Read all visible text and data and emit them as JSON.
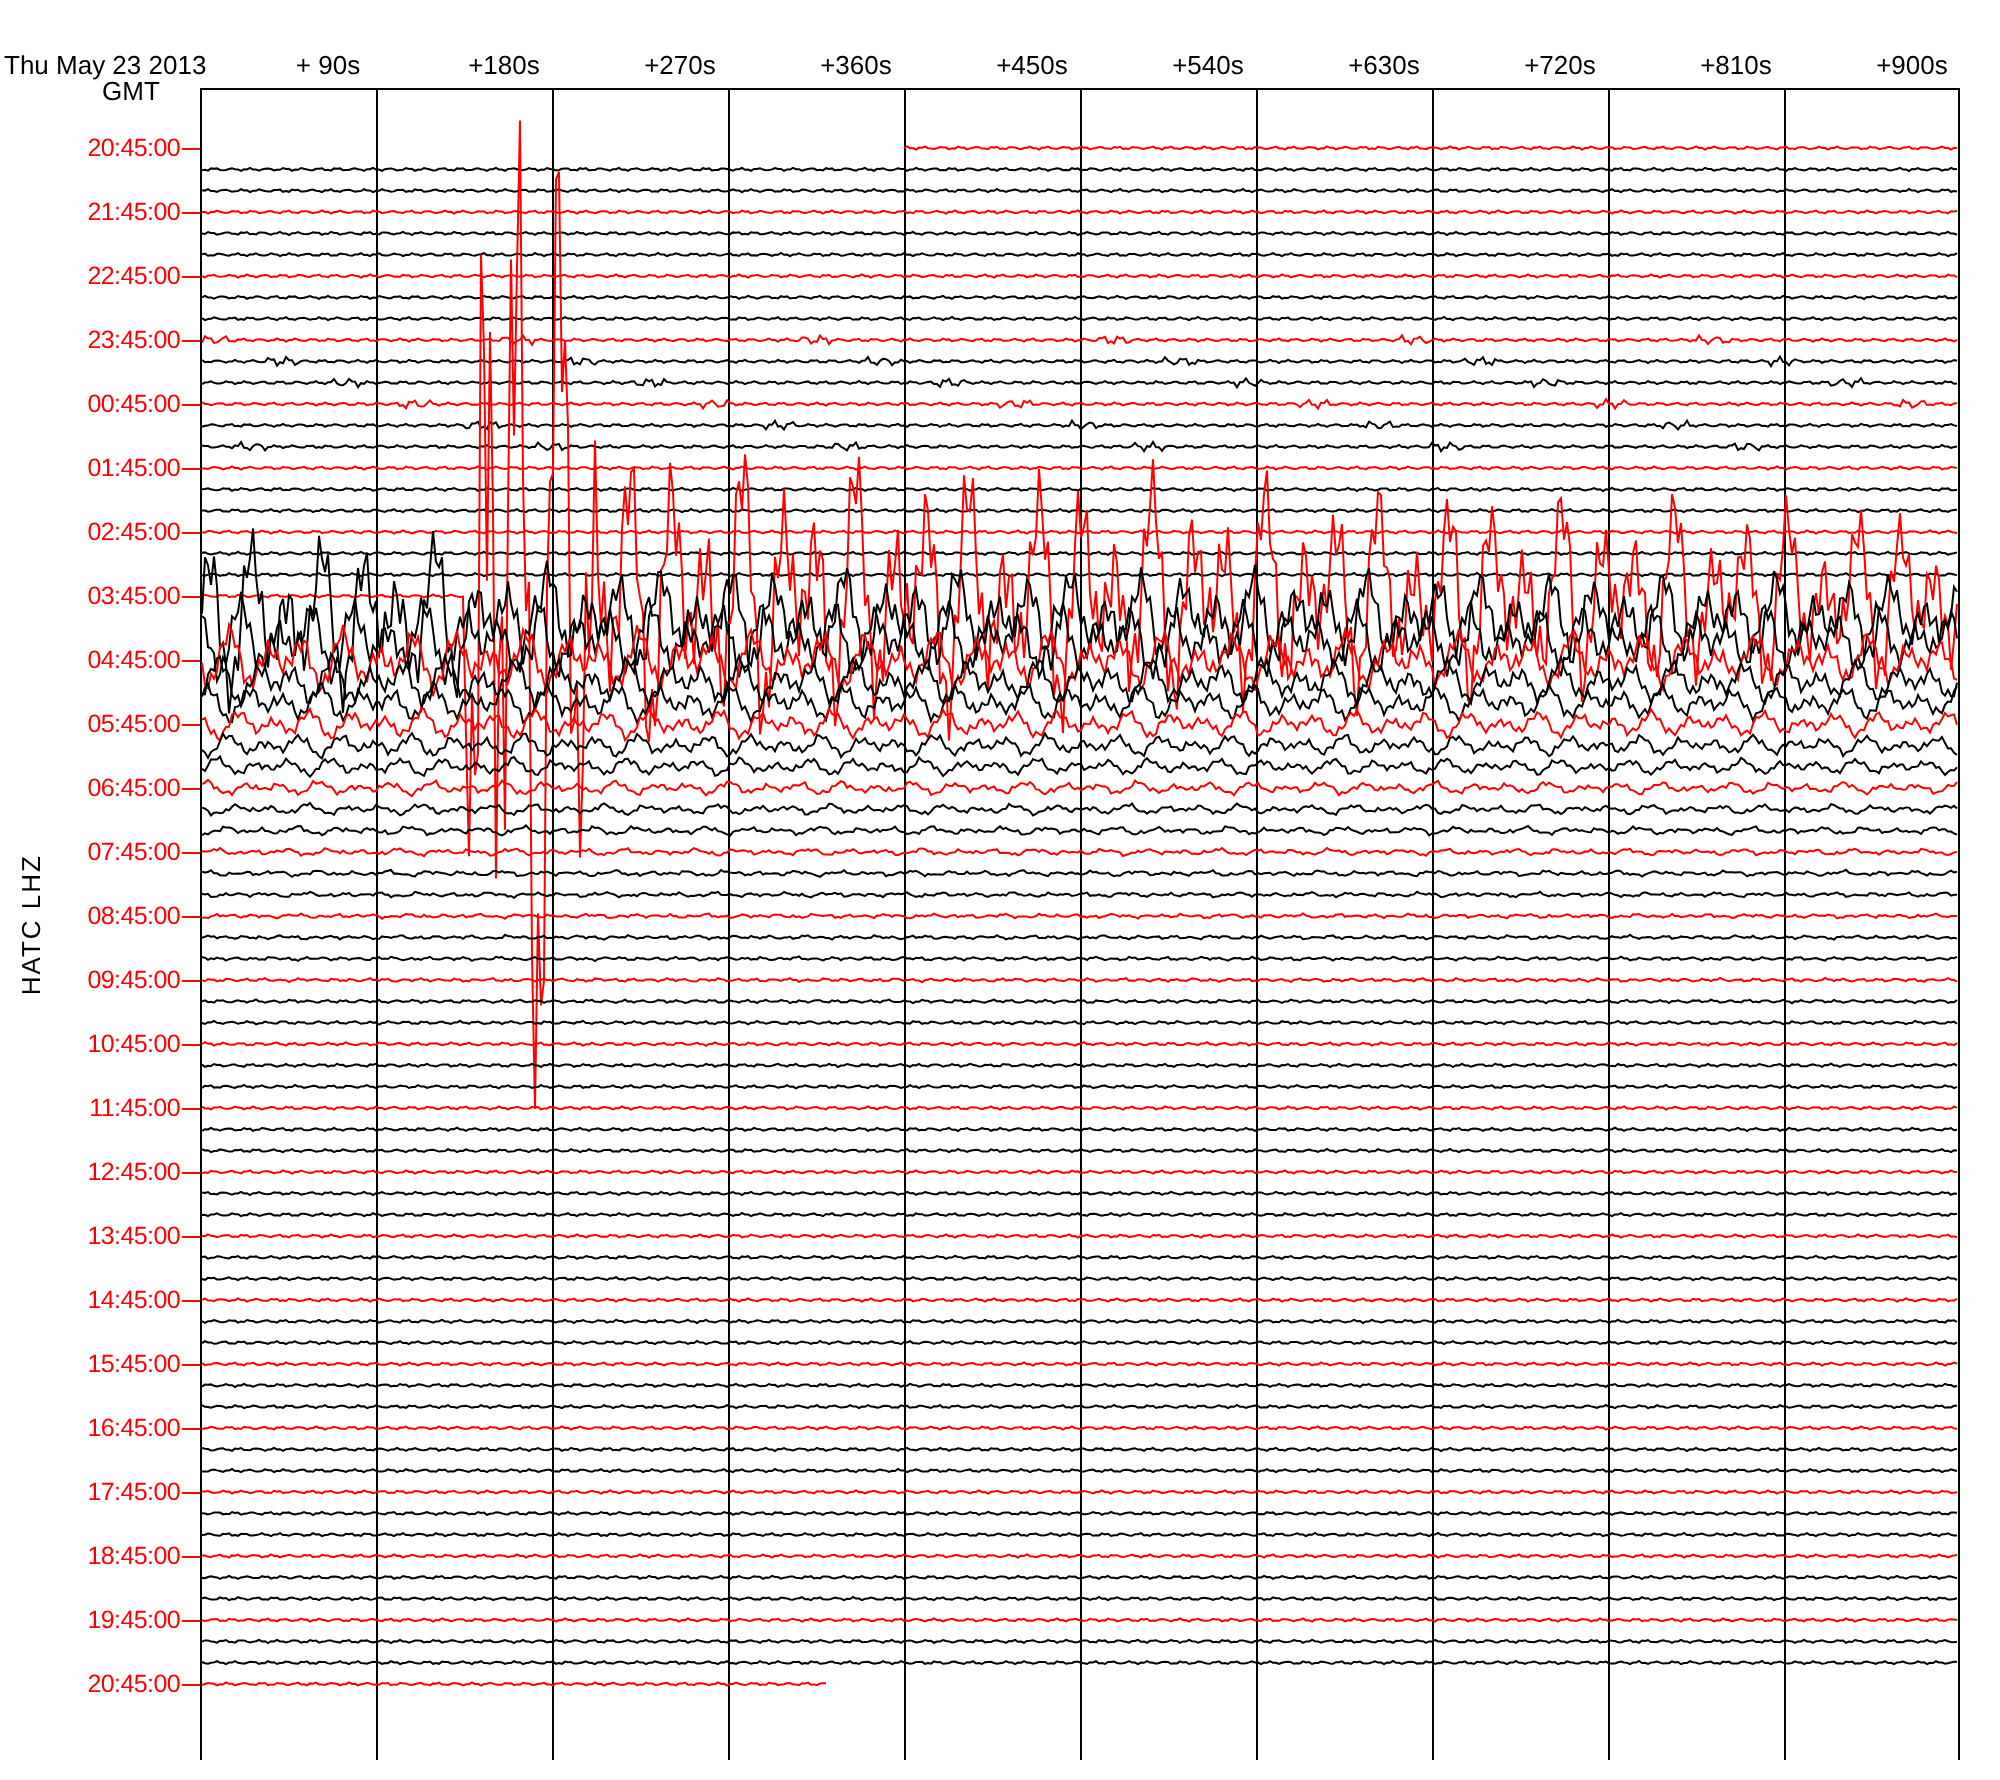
{
  "header": {
    "date": "Thu May 23 2013",
    "timezone": "GMT"
  },
  "time_offsets": [
    "+ 90s",
    "+180s",
    "+270s",
    "+360s",
    "+450s",
    "+540s",
    "+630s",
    "+720s",
    "+810s",
    "+900s"
  ],
  "station": "HATC LHZ",
  "hour_labels": [
    "20:45:00",
    "21:45:00",
    "22:45:00",
    "23:45:00",
    "00:45:00",
    "01:45:00",
    "02:45:00",
    "03:45:00",
    "04:45:00",
    "05:45:00",
    "06:45:00",
    "07:45:00",
    "08:45:00",
    "09:45:00",
    "10:45:00",
    "11:45:00",
    "12:45:00",
    "13:45:00",
    "14:45:00",
    "15:45:00",
    "16:45:00",
    "17:45:00",
    "18:45:00",
    "19:45:00",
    "20:45:00"
  ]
}
